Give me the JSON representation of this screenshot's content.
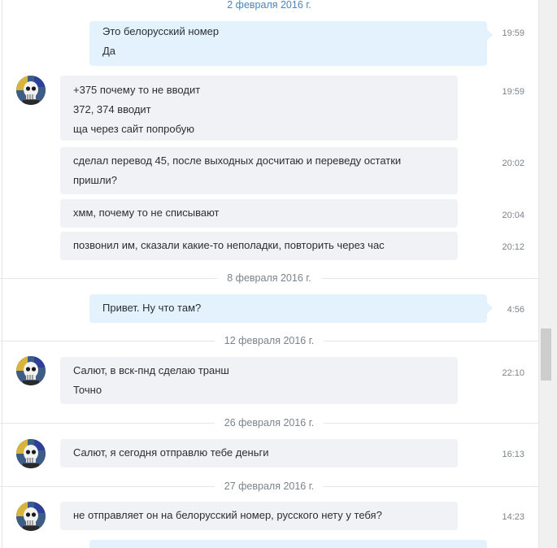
{
  "dates": {
    "d1": "2 февраля 2016 г.",
    "d2": "8 февраля 2016 г.",
    "d3": "12 февраля 2016 г.",
    "d4": "26 февраля 2016 г.",
    "d5": "27 февраля 2016 г."
  },
  "messages": {
    "m1": {
      "lines": [
        "Это белорусский номер",
        "Да"
      ],
      "time": "19:59",
      "direction": "outgoing"
    },
    "m2": {
      "lines": [
        "+375 почему то не вводит",
        "372, 374 вводит",
        "ща через сайт попробую"
      ],
      "time": "19:59",
      "direction": "incoming"
    },
    "m3": {
      "lines": [
        "сделал перевод 45, после выходных досчитаю и переведу остатки",
        "пришли?"
      ],
      "time": "20:02",
      "direction": "incoming"
    },
    "m4": {
      "lines": [
        "хмм, почему то не списывают"
      ],
      "time": "20:04",
      "direction": "incoming"
    },
    "m5": {
      "lines": [
        "позвонил им, сказали какие-то неполадки, повторить через час"
      ],
      "time": "20:12",
      "direction": "incoming"
    },
    "m6": {
      "lines": [
        "Привет. Ну что там?"
      ],
      "time": "4:56",
      "direction": "outgoing"
    },
    "m7": {
      "lines": [
        "Салют, в вск-пнд сделаю транш",
        "Точно"
      ],
      "time": "22:10",
      "direction": "incoming"
    },
    "m8": {
      "lines": [
        "Салют, я сегодня отправлю тебе деньги"
      ],
      "time": "16:13",
      "direction": "incoming"
    },
    "m9": {
      "lines": [
        "не отправляет он на белорусский номер, русского нету у тебя?"
      ],
      "time": "14:23",
      "direction": "incoming"
    }
  },
  "colors": {
    "incoming_bubble": "#f0f2f5",
    "outgoing_bubble": "#e4f2fd",
    "date_link": "#4a86b8",
    "muted_text": "#7a838c"
  },
  "icons": {
    "contact_avatar": "skull-avatar-icon"
  }
}
